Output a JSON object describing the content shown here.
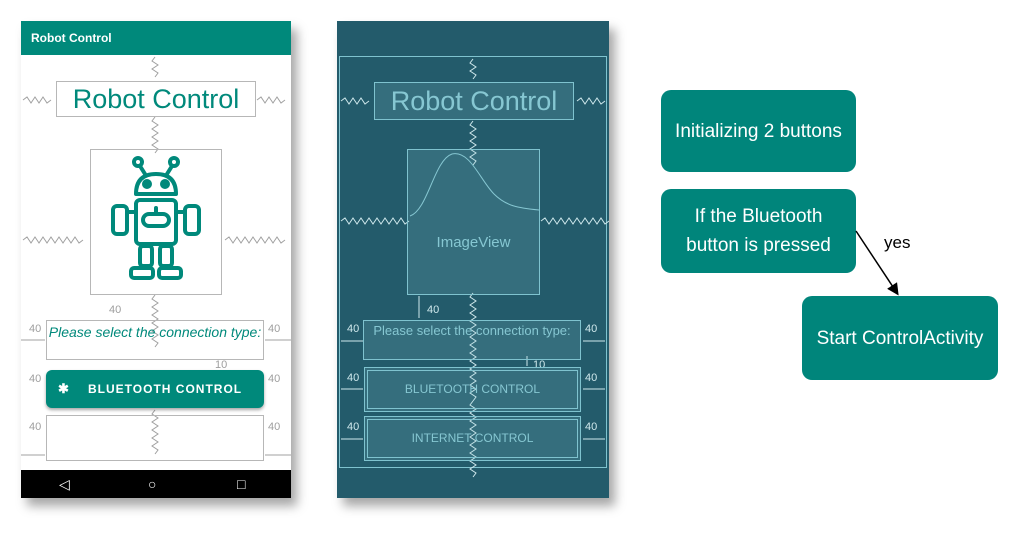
{
  "phone": {
    "appbar_title": "Robot Control",
    "title": "Robot Control",
    "prompt": "Please select the connection type:",
    "button_label": "BLUETOOTH CONTROL",
    "button_icon": "bluetooth-icon",
    "image_icon": "robot-icon",
    "margin_labels": [
      "40",
      "40",
      "40",
      "40",
      "40",
      "40",
      "40",
      "10"
    ],
    "nav_icons": [
      "back-icon",
      "home-icon",
      "recents-icon"
    ]
  },
  "blueprint": {
    "title": "Robot Control",
    "image_label": "ImageView",
    "prompt": "Please select the connection type:",
    "button1_label": "BLUETOOTH CONTROL",
    "button2_label": "INTERNET CONTROL",
    "margin_labels": [
      "40",
      "40",
      "40",
      "40",
      "40",
      "40",
      "40",
      "10"
    ]
  },
  "flow": {
    "box1": "Initializing 2 buttons",
    "box2": "If the Bluetooth button is pressed",
    "box3": "Start ControlActivity",
    "edge_label": "yes"
  },
  "colors": {
    "teal": "#00897b",
    "blueprint_bg": "#235b6b",
    "flow_box": "#00857b"
  }
}
